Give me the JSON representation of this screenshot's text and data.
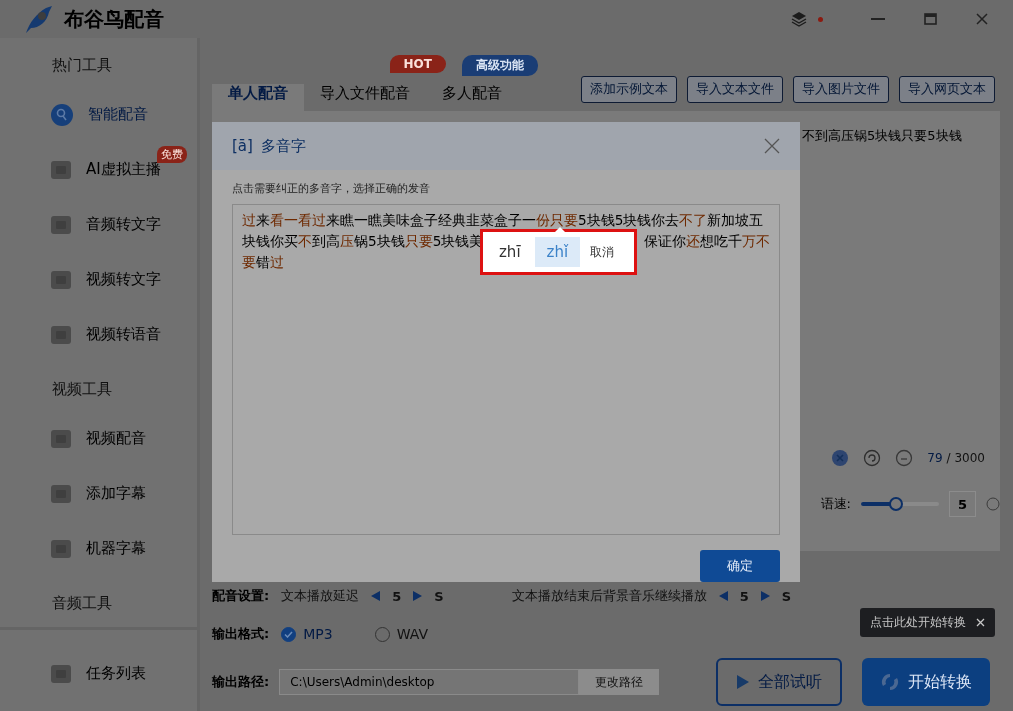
{
  "app": {
    "title": "布谷鸟配音",
    "notification_dot": true
  },
  "sidebar": {
    "sections": [
      {
        "title": "热门工具",
        "items": [
          {
            "label": "智能配音",
            "selected": true
          },
          {
            "label": "AI虚拟主播",
            "selected": false,
            "badge": "免费"
          },
          {
            "label": "音频转文字",
            "selected": false
          },
          {
            "label": "视频转文字",
            "selected": false
          },
          {
            "label": "视频转语音",
            "selected": false
          }
        ]
      },
      {
        "title": "视频工具",
        "items": [
          {
            "label": "视频配音",
            "selected": false
          },
          {
            "label": "添加字幕",
            "selected": false
          },
          {
            "label": "机器字幕",
            "selected": false
          }
        ]
      },
      {
        "title": "音频工具"
      }
    ],
    "footer_item": {
      "label": "任务列表",
      "selected": false
    }
  },
  "tabs": [
    {
      "label": "单人配音",
      "selected": true
    },
    {
      "label": "导入文件配音",
      "selected": false,
      "badge": "HOT"
    },
    {
      "label": "多人配音",
      "selected": false,
      "badge": "高级功能"
    }
  ],
  "toolbar_buttons": [
    "添加示例文本",
    "导入文本文件",
    "导入图片文件",
    "导入网页文本"
  ],
  "editor": {
    "visible_text": "不到高压锅5块钱只要5块钱",
    "count": "79",
    "limit": "/ 3000"
  },
  "speed": {
    "label": "语速:",
    "level": 0.45,
    "value": "5"
  },
  "settings": {
    "label": "配音设置:",
    "delay_label": "文本播放延迟",
    "delay_value": "5",
    "delay_unit": "S",
    "bgm_label": "文本播放结束后背景音乐继续播放",
    "bgm_value": "5",
    "bgm_unit": "S"
  },
  "format": {
    "label": "输出格式:",
    "options": [
      {
        "label": "MP3",
        "selected": true
      },
      {
        "label": "WAV",
        "selected": false
      }
    ]
  },
  "output_path": {
    "label": "输出路径:",
    "value": "C:\\Users\\Admin\\desktop",
    "button": "更改路径"
  },
  "actions": {
    "preview": "全部试听",
    "start": "开始转换",
    "tooltip": "点击此处开始转换"
  },
  "dialog": {
    "title_mark": "[ā]",
    "title": "多音字",
    "hint": "点击需要纠正的多音字，选择正确的发音",
    "confirm": "确定",
    "lines": [
      [
        [
          {
            "text": "过",
            "marked": true
          },
          {
            "text": "来",
            "marked": false
          },
          {
            "text": "看一看过",
            "marked": true
          },
          {
            "text": "来瞧一瞧美味盒子经典韭菜盒子一",
            "marked": false
          },
          {
            "text": "份只要",
            "marked": true
          },
          {
            "text": "5块钱5块钱你去",
            "marked": false
          },
          {
            "text": "不了",
            "marked": true
          },
          {
            "text": "新加坡五",
            "marked": false
          }
        ]
      ],
      [
        [
          {
            "text": "块钱你买",
            "marked": false
          },
          {
            "text": "不",
            "marked": true
          },
          {
            "text": "到高",
            "marked": false
          },
          {
            "text": "压",
            "marked": true
          },
          {
            "text": "锅5块钱",
            "marked": false
          },
          {
            "text": "只要",
            "marked": true
          },
          {
            "text": "5块钱美",
            "marked": false
          }
        ],
        [
          {
            "text": "保证你",
            "marked": false
          },
          {
            "text": "还",
            "marked": true
          },
          {
            "text": "想吃千",
            "marked": false
          },
          {
            "text": "万不",
            "marked": true
          }
        ]
      ],
      [
        [
          {
            "text": "要",
            "marked": true
          },
          {
            "text": "错",
            "marked": false
          },
          {
            "text": "过",
            "marked": true
          }
        ]
      ]
    ],
    "pinyin_options": [
      {
        "label": "zhī",
        "selected": false
      },
      {
        "label": "zhǐ",
        "selected": true
      }
    ],
    "cancel": "取消"
  }
}
